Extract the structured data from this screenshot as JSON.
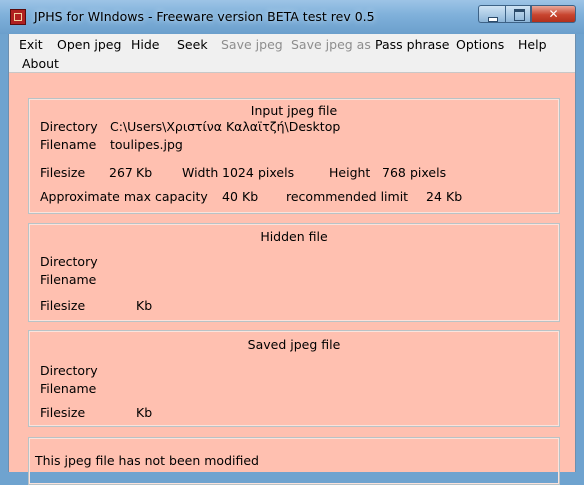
{
  "window": {
    "title": "JPHS for WIndows - Freeware version BETA test rev 0.5"
  },
  "icons": {
    "app": "app-icon",
    "minimize": "minimize-icon",
    "maximize": "maximize-icon",
    "close": "close-icon"
  },
  "menu": {
    "exit": "Exit",
    "open_jpeg": "Open jpeg",
    "hide": "Hide",
    "seek": "Seek",
    "save_jpeg": "Save jpeg",
    "save_jpeg_as": "Save jpeg as",
    "pass_phrase": "Pass phrase",
    "options": "Options",
    "help": "Help",
    "about": "About"
  },
  "input_jpeg": {
    "title": "Input jpeg file",
    "directory_label": "Directory",
    "directory_value": "C:\\Users\\Χριστίνα Καλαϊτζή\\Desktop",
    "filename_label": "Filename",
    "filename_value": "toulipes.jpg",
    "filesize_label": "Filesize",
    "filesize_value": "267",
    "filesize_unit": "Kb",
    "width_label": "Width",
    "width_value": "1024",
    "width_unit": "pixels",
    "height_label": "Height",
    "height_value": "768",
    "height_unit": "pixels",
    "capacity_label": "Approximate max capacity",
    "capacity_value": "40",
    "capacity_unit": "Kb",
    "recommended_label": "recommended limit",
    "recommended_value": "24",
    "recommended_unit": "Kb"
  },
  "hidden_file": {
    "title": "Hidden file",
    "directory_label": "Directory",
    "filename_label": "Filename",
    "filesize_label": "Filesize",
    "filesize_unit": "Kb"
  },
  "saved_jpeg": {
    "title": "Saved jpeg file",
    "directory_label": "Directory",
    "filename_label": "Filename",
    "filesize_label": "Filesize",
    "filesize_unit": "Kb"
  },
  "status": {
    "message": "This jpeg file has not been modified"
  },
  "colors": {
    "panel_background": "#ffc0b0",
    "menubar_background": "#f0f0f0",
    "titlebar": "#7fb0da",
    "close_button": "#c8452f"
  }
}
